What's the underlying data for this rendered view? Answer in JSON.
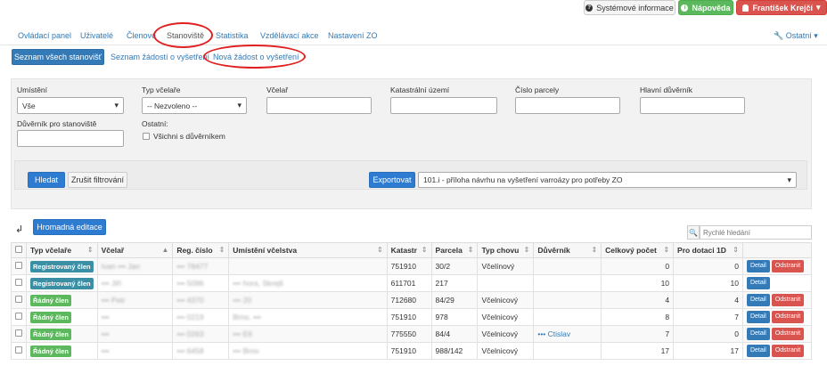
{
  "top_actions": {
    "system_info": "Systémové informace",
    "help": "Nápověda",
    "user": "František Krejčí"
  },
  "nav": {
    "items": [
      "Ovládací panel",
      "Uživatelé",
      "Členové",
      "Stanoviště",
      "Statistika",
      "Vzdělávací akce",
      "Nastavení ZO"
    ],
    "active": "Stanoviště",
    "other": "Ostatní"
  },
  "subnav": {
    "active": "Seznam všech stanovišť",
    "items": [
      "Seznam žádostí o vyšetření",
      "Nová žádost o vyšetření"
    ]
  },
  "filters": {
    "umisteni_label": "Umístění",
    "umisteni_value": "Vše",
    "typ_label": "Typ včelaře",
    "typ_value": "-- Nezvoleno --",
    "vcelar_label": "Včelař",
    "katastr_label": "Katastrální území",
    "parcela_label": "Číslo parcely",
    "hlavni_label": "Hlavní důvěrník",
    "duvernik_label": "Důvěrník pro stanoviště",
    "ostatni_label": "Ostatní:",
    "vsichni_label": "Všichni s důvěrníkem",
    "search_btn": "Hledat",
    "reset_btn": "Zrušit filtrování",
    "export_btn": "Exportovat",
    "export_value": "101.i - příloha návrhu na vyšetření varroázy pro potřeby ZO"
  },
  "bulk_edit": "Hromadná editace",
  "quick_search_placeholder": "Rychlé hledání",
  "table": {
    "headers": [
      "Typ včelaře",
      "Včelař",
      "Reg. číslo",
      "Umístění včelstva",
      "Katastr",
      "Parcela",
      "Typ chovu",
      "Důvěrník",
      "Celkový počet",
      "Pro dotaci 1D"
    ],
    "detail": "Detail",
    "delete": "Odstranit",
    "rows": [
      {
        "typ": "Registrovaný člen",
        "badge": "reg",
        "vcelar": "Ivan ••• Jan",
        "reg": "••• 78477",
        "umisteni": "",
        "katastr": "751910",
        "parcela": "30/2",
        "chov": "Včelínový",
        "duvernik": "",
        "celkem": "0",
        "dotace": "0",
        "odstranit": true
      },
      {
        "typ": "Registrovaný člen",
        "badge": "reg",
        "vcelar": "••• Jiří",
        "reg": "••• 5096",
        "umisteni": "••• hora, Skrejš",
        "katastr": "611701",
        "parcela": "217",
        "chov": "",
        "duvernik": "",
        "celkem": "10",
        "dotace": "10",
        "odstranit": false
      },
      {
        "typ": "Řádný člen",
        "badge": "rad",
        "vcelar": "••• Petr",
        "reg": "••• 4370",
        "umisteni": "••• 20",
        "katastr": "712680",
        "parcela": "84/29",
        "chov": "Včelnicový",
        "duvernik": "",
        "celkem": "4",
        "dotace": "4",
        "odstranit": true
      },
      {
        "typ": "Řádný člen",
        "badge": "rad",
        "vcelar": "•••",
        "reg": "••• 0219",
        "umisteni": "Brno, •••",
        "katastr": "751910",
        "parcela": "978",
        "chov": "Včelnicový",
        "duvernik": "",
        "celkem": "8",
        "dotace": "7",
        "odstranit": true
      },
      {
        "typ": "Řádný člen",
        "badge": "rad",
        "vcelar": "••• ",
        "reg": "••• 0263",
        "umisteni": "••• E6",
        "katastr": "775550",
        "parcela": "84/4",
        "chov": "Včelnicový",
        "duvernik": "••• Ctislav",
        "celkem": "7",
        "dotace": "0",
        "odstranit": true
      },
      {
        "typ": "Řádný člen",
        "badge": "rad",
        "vcelar": "•••",
        "reg": "••• 6458",
        "umisteni": "••• Brno",
        "katastr": "751910",
        "parcela": "988/142",
        "chov": "Včelnicový",
        "duvernik": "",
        "celkem": "17",
        "dotace": "17",
        "odstranit": true
      }
    ]
  }
}
